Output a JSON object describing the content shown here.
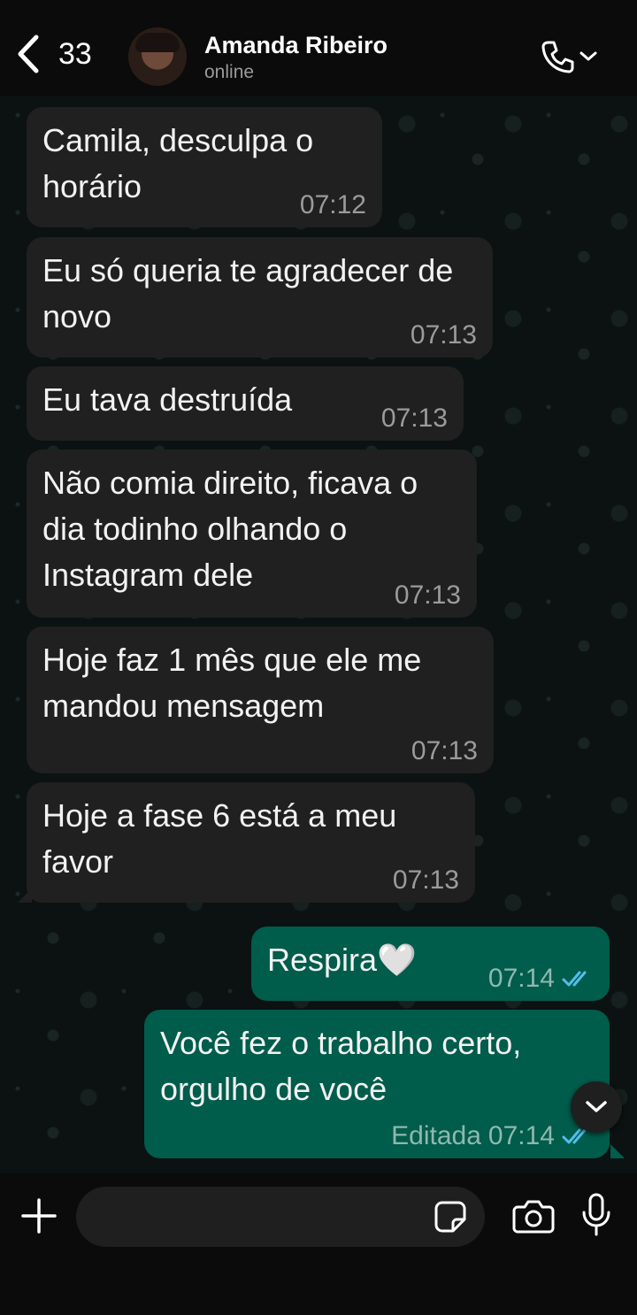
{
  "header": {
    "back_count": "33",
    "contact_name": "Amanda Ribeiro",
    "status": "online"
  },
  "messages": [
    {
      "direction": "in",
      "text": "Camila, desculpa o horário",
      "time": "07:12"
    },
    {
      "direction": "in",
      "text": "Eu só queria te agradecer de novo",
      "time": "07:13"
    },
    {
      "direction": "in",
      "text": "Eu tava destruída",
      "time": "07:13"
    },
    {
      "direction": "in",
      "text": "Não comia direito, ficava o dia todinho olhando o Instagram dele",
      "time": "07:13"
    },
    {
      "direction": "in",
      "text": "Hoje faz 1 mês que ele me mandou mensagem",
      "time": "07:13"
    },
    {
      "direction": "in",
      "text": "Hoje a fase 6 está a meu favor",
      "time": "07:13"
    },
    {
      "direction": "out",
      "text": "Respira🤍",
      "time": "07:14",
      "status": "read"
    },
    {
      "direction": "out",
      "text": "Você fez o trabalho certo, orgulho de você",
      "time": "07:14",
      "edited_label": "Editada",
      "status": "read"
    }
  ],
  "colors": {
    "incoming_bubble": "#202020",
    "outgoing_bubble": "#005c4b",
    "read_ticks": "#53bdeb",
    "background": "#0b0f0f"
  },
  "icons": {
    "back": "chevron-left-icon",
    "call": "phone-icon",
    "attach": "plus-icon",
    "sticker": "sticker-icon",
    "camera": "camera-icon",
    "mic": "microphone-icon",
    "scroll": "chevron-down-icon"
  }
}
